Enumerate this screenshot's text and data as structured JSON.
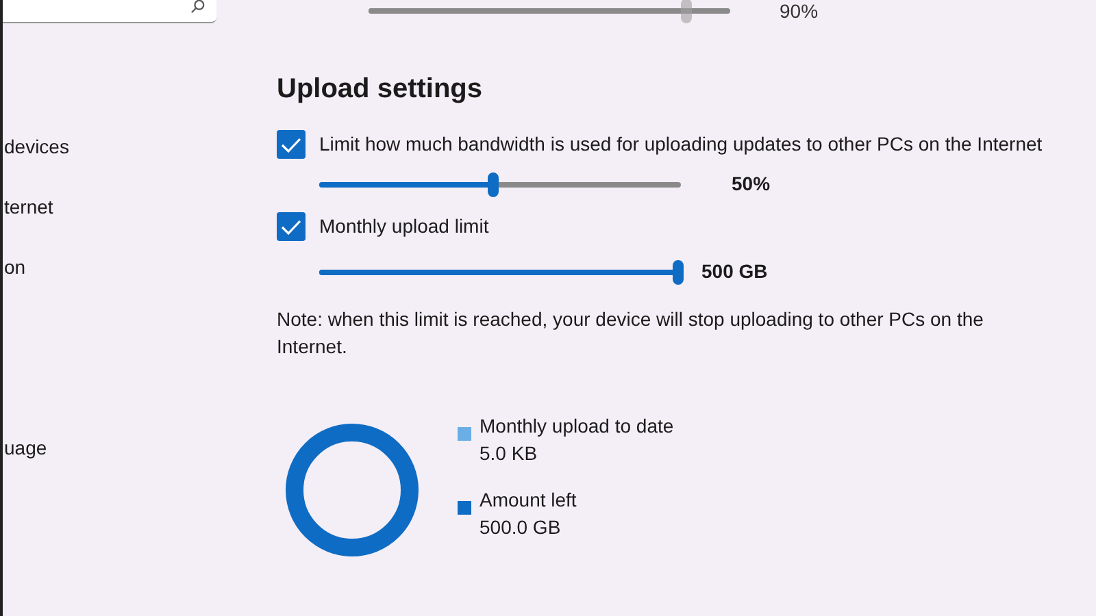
{
  "sidebar": {
    "items": [
      {
        "label": "devices"
      },
      {
        "label": "ternet"
      },
      {
        "label": "on"
      },
      {
        "label": "uage"
      }
    ]
  },
  "download_slider": {
    "level": 0.88,
    "reading": "90%",
    "disabled": true
  },
  "upload_settings": {
    "title": "Upload settings",
    "options": [
      {
        "label": "Limit how much bandwidth is used for uploading updates to other PCs on the Internet",
        "checked": true,
        "level": 0.48,
        "reading": "50%",
        "disabled": false
      },
      {
        "label": "Monthly upload limit",
        "checked": true,
        "level": 1,
        "reading": "500 GB",
        "disabled": false
      }
    ],
    "note": "Note: when this limit is reached, your device will stop uploading to other PCs on the Internet.",
    "legend": [
      {
        "label": "Monthly upload to date",
        "value": "5.0 KB",
        "color": "#6aaee6"
      },
      {
        "label": "Amount left",
        "value": "500.0 GB",
        "color": "#0f6cc4"
      }
    ]
  }
}
